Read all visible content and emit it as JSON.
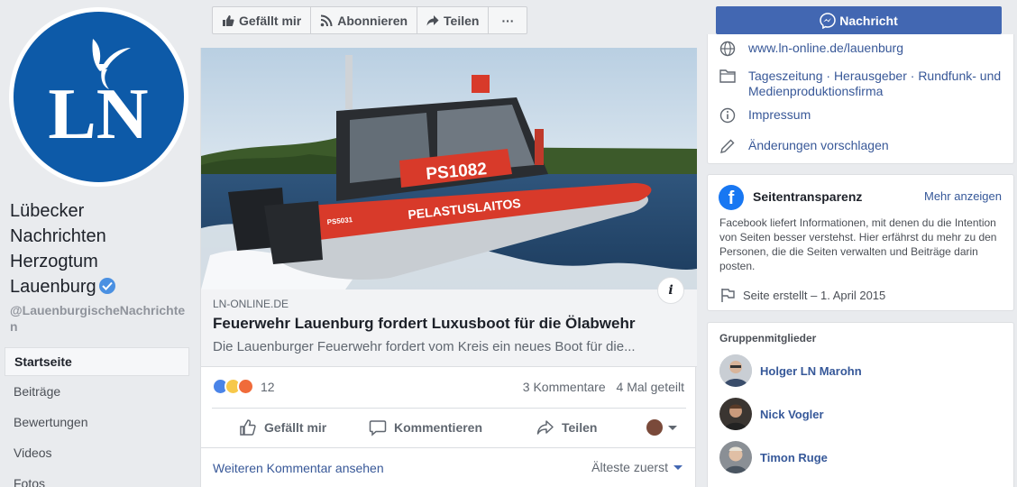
{
  "page": {
    "name": "Lübecker Nachrichten Herzogtum Lauenburg",
    "name_lines": [
      "Lübecker",
      "Nachrichten",
      "Herzogtum",
      "Lauenburg"
    ],
    "handle": "@LauenburgischeNachrichten",
    "logo_text": "LN",
    "brand_color": "#0d5aa8"
  },
  "nav": {
    "items": [
      {
        "label": "Startseite",
        "active": true
      },
      {
        "label": "Beiträge"
      },
      {
        "label": "Bewertungen"
      },
      {
        "label": "Videos"
      },
      {
        "label": "Fotos"
      }
    ]
  },
  "toolbar": {
    "like_label": "Gefällt mir",
    "subscribe_label": "Abonnieren",
    "share_label": "Teilen",
    "more_label": "···"
  },
  "post": {
    "boat_text": "PS1082",
    "boat_side_text": "PELASTUSLAITOS",
    "boat_hull_text": "PS5031",
    "link_domain": "LN-ONLINE.DE",
    "link_title": "Feuerwehr Lauenburg fordert Luxusboot für die Ölabwehr",
    "link_desc": "Die Lauenburger Feuerwehr fordert vom Kreis ein neues Boot für die...",
    "info_label": "i",
    "reaction_count": "12",
    "comments": "3 Kommentare",
    "shares": "4 Mal geteilt",
    "actions": {
      "like": "Gefällt mir",
      "comment": "Kommentieren",
      "share": "Teilen"
    },
    "more_comments": "Weiteren Kommentar ansehen",
    "sort": "Älteste zuerst"
  },
  "message_button": "Nachricht",
  "about": {
    "website": "www.ln-online.de/lauenburg",
    "categories_line1": "Tageszeitung · Herausgeber · Rundfunk- und",
    "categories_line2": "Medienproduktionsfirma",
    "impressum": "Impressum",
    "suggest": "Änderungen vorschlagen"
  },
  "transparency": {
    "logo": "f",
    "title": "Seitentransparenz",
    "more": "Mehr anzeigen",
    "desc": "Facebook liefert Informationen, mit denen du die Intention von Seiten besser verstehst. Hier erfährst du mehr zu den Personen, die die Seiten verwalten und Beiträge darin posten.",
    "created": "Seite erstellt – 1. April 2015"
  },
  "members": {
    "title": "Gruppenmitglieder",
    "list": [
      {
        "name": "Holger LN Marohn"
      },
      {
        "name": "Nick Vogler"
      },
      {
        "name": "Timon Ruge"
      }
    ]
  },
  "colors": {
    "facebook_blue": "#4267b2",
    "link_blue": "#385898"
  }
}
